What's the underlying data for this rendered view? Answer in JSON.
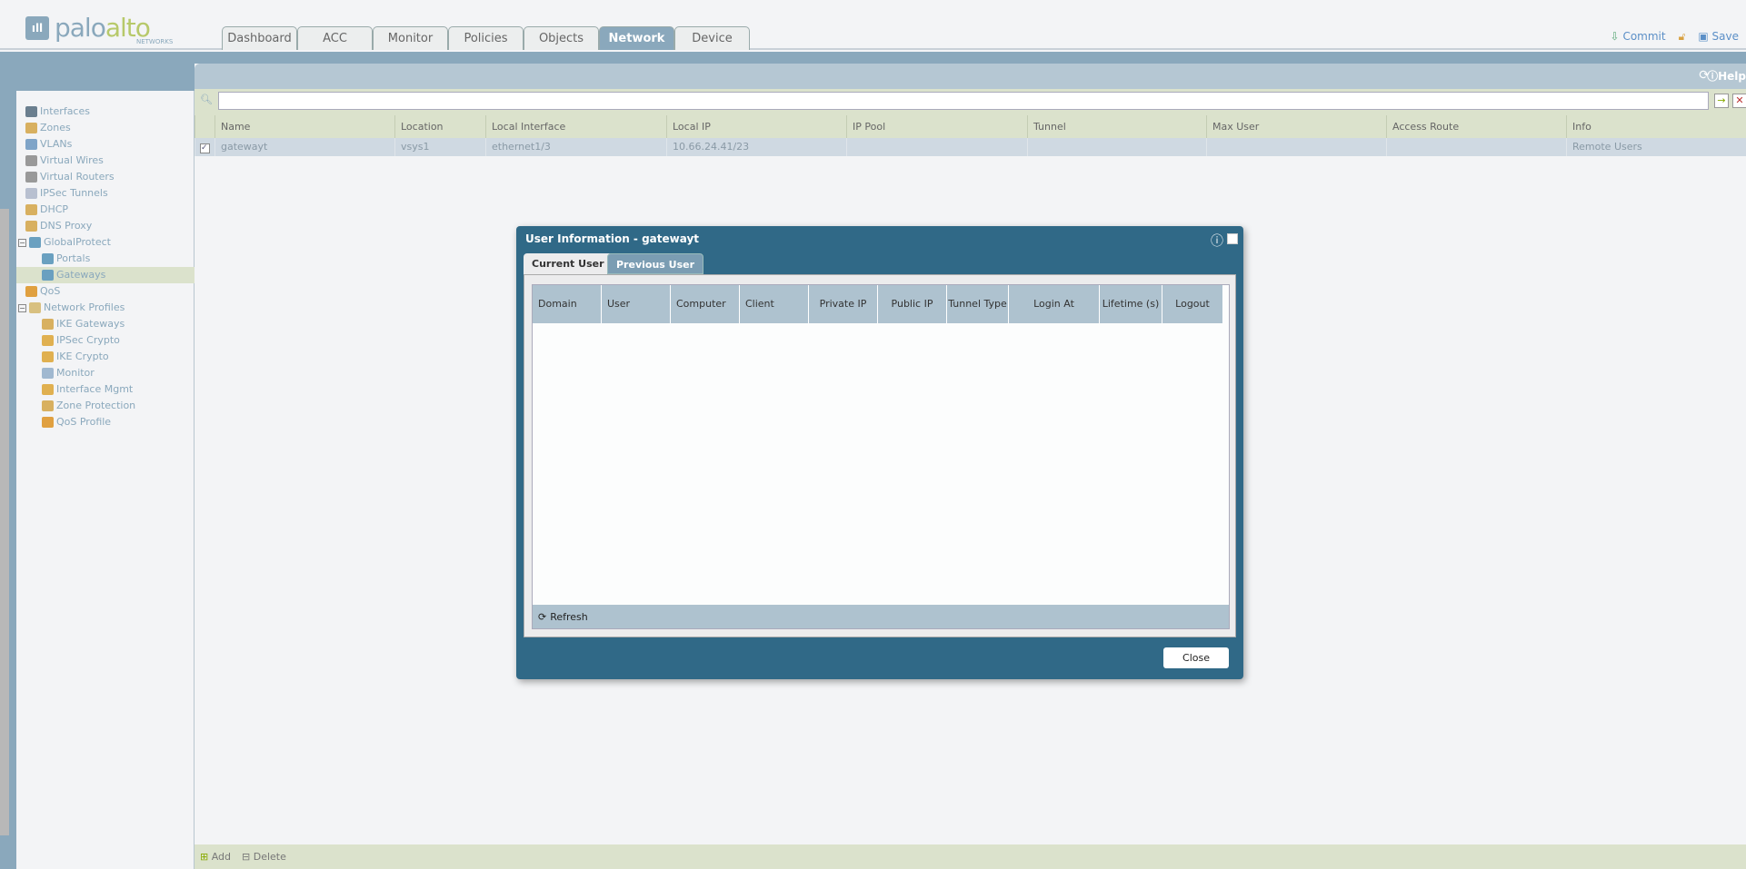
{
  "brand": {
    "logo_text": "paloalto",
    "logo_sub": "NETWORKS"
  },
  "tabs": [
    "Dashboard",
    "ACC",
    "Monitor",
    "Policies",
    "Objects",
    "Network",
    "Device"
  ],
  "active_tab": "Network",
  "toolbar": {
    "commit": "Commit",
    "save": "Save",
    "help": "Help"
  },
  "sidebar": {
    "items": [
      {
        "label": "Interfaces",
        "level": 0,
        "icon": "interfaces-icon",
        "color": "#6b7f8f"
      },
      {
        "label": "Zones",
        "level": 0,
        "icon": "zones-icon",
        "color": "#d8b060"
      },
      {
        "label": "VLANs",
        "level": 0,
        "icon": "vlans-icon",
        "color": "#7fa4c8"
      },
      {
        "label": "Virtual Wires",
        "level": 0,
        "icon": "virtual-wires-icon",
        "color": "#999"
      },
      {
        "label": "Virtual Routers",
        "level": 0,
        "icon": "virtual-routers-icon",
        "color": "#999"
      },
      {
        "label": "IPSec Tunnels",
        "level": 0,
        "icon": "ipsec-tunnels-icon",
        "color": "#b8c0d0"
      },
      {
        "label": "DHCP",
        "level": 0,
        "icon": "dhcp-icon",
        "color": "#d8b060"
      },
      {
        "label": "DNS Proxy",
        "level": 0,
        "icon": "dns-proxy-icon",
        "color": "#d8b060"
      },
      {
        "label": "GlobalProtect",
        "level": 0,
        "icon": "globalprotect-icon",
        "color": "#6aa0c0",
        "expander": "−"
      },
      {
        "label": "Portals",
        "level": 1,
        "icon": "portals-icon",
        "color": "#6aa0c0"
      },
      {
        "label": "Gateways",
        "level": 1,
        "icon": "gateways-icon",
        "color": "#6aa0c0",
        "selected": true
      },
      {
        "label": "QoS",
        "level": 0,
        "icon": "qos-icon",
        "color": "#e0a040"
      },
      {
        "label": "Network Profiles",
        "level": 0,
        "icon": "network-profiles-icon",
        "color": "#d8c080",
        "expander": "−"
      },
      {
        "label": "IKE Gateways",
        "level": 1,
        "icon": "ike-gateways-icon",
        "color": "#d8b060"
      },
      {
        "label": "IPSec Crypto",
        "level": 1,
        "icon": "ipsec-crypto-icon",
        "color": "#e0b050"
      },
      {
        "label": "IKE Crypto",
        "level": 1,
        "icon": "ike-crypto-icon",
        "color": "#e0b050"
      },
      {
        "label": "Monitor",
        "level": 1,
        "icon": "monitor-icon",
        "color": "#a0b8d0"
      },
      {
        "label": "Interface Mgmt",
        "level": 1,
        "icon": "interface-mgmt-icon",
        "color": "#e0b050"
      },
      {
        "label": "Zone Protection",
        "level": 1,
        "icon": "zone-protection-icon",
        "color": "#d8b060"
      },
      {
        "label": "QoS Profile",
        "level": 1,
        "icon": "qos-profile-icon",
        "color": "#e0a040"
      }
    ]
  },
  "table": {
    "columns": [
      "Name",
      "Location",
      "Local Interface",
      "Local IP",
      "IP Pool",
      "Tunnel",
      "Max User",
      "Access Route",
      "Info"
    ],
    "rows": [
      [
        "gatewayt",
        "vsys1",
        "ethernet1/3",
        "10.66.24.41/23",
        "",
        "",
        "",
        "",
        "Remote Users"
      ]
    ],
    "row_checked": true
  },
  "bottom": {
    "add": "Add",
    "delete": "Delete"
  },
  "dialog": {
    "title": "User Information - gatewayt",
    "tabs": [
      "Current User",
      "Previous User"
    ],
    "active_tab": "Current User",
    "columns": [
      "Domain",
      "User",
      "Computer",
      "Client",
      "Private IP",
      "Public IP",
      "Tunnel Type",
      "Login At",
      "Lifetime (s)",
      "Logout"
    ],
    "refresh": "Refresh",
    "close": "Close"
  }
}
